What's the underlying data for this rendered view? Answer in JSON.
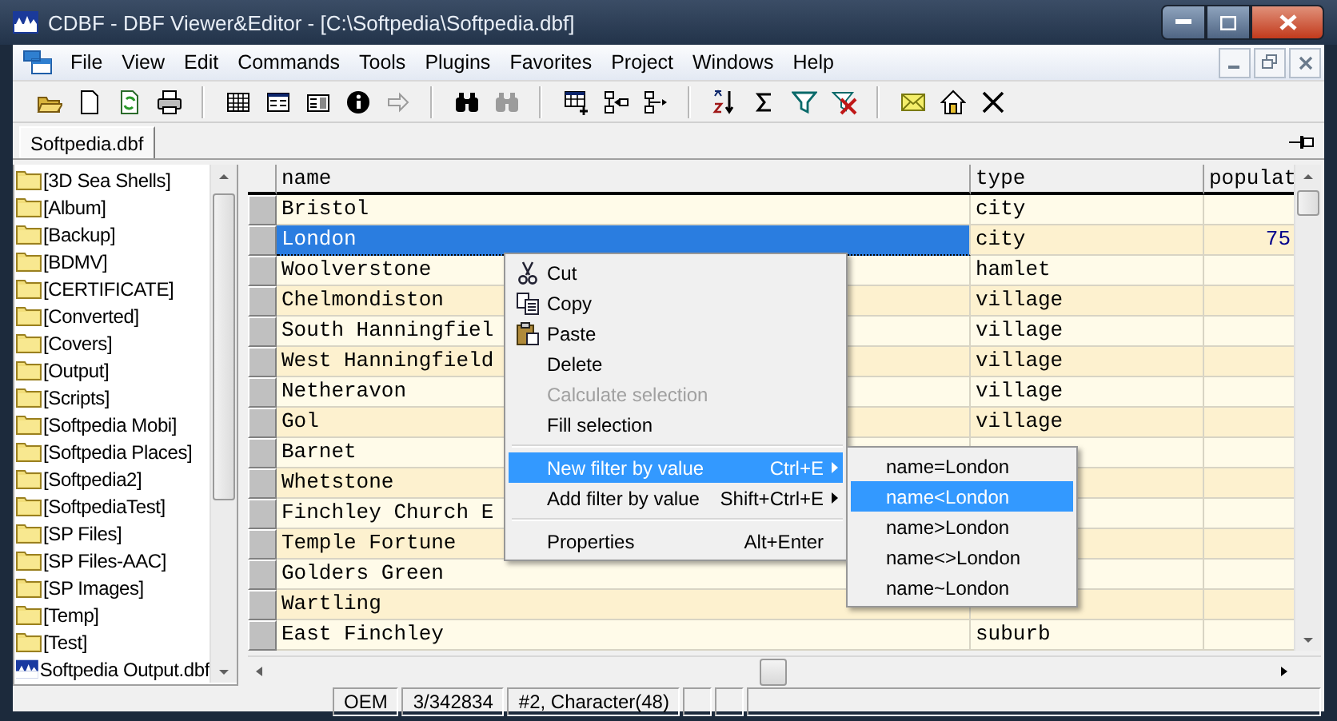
{
  "window": {
    "title": "CDBF - DBF Viewer&Editor - [C:\\Softpedia\\Softpedia.dbf]"
  },
  "menu_bar": [
    "File",
    "View",
    "Edit",
    "Commands",
    "Tools",
    "Plugins",
    "Favorites",
    "Project",
    "Windows",
    "Help"
  ],
  "toolbar": [
    {
      "kind": "open",
      "disabled": false
    },
    {
      "kind": "new",
      "disabled": false
    },
    {
      "kind": "refresh",
      "disabled": false
    },
    {
      "kind": "print",
      "disabled": false
    },
    {
      "kind": "separator"
    },
    {
      "kind": "grid",
      "disabled": false
    },
    {
      "kind": "form",
      "disabled": false
    },
    {
      "kind": "form2",
      "disabled": false
    },
    {
      "kind": "info",
      "disabled": false
    },
    {
      "kind": "arrow",
      "disabled": true
    },
    {
      "kind": "separator"
    },
    {
      "kind": "find",
      "disabled": false
    },
    {
      "kind": "find",
      "disabled": true
    },
    {
      "kind": "separator"
    },
    {
      "kind": "addrow",
      "disabled": false
    },
    {
      "kind": "colleft",
      "disabled": false
    },
    {
      "kind": "colright",
      "disabled": false
    },
    {
      "kind": "separator"
    },
    {
      "kind": "sort",
      "disabled": false
    },
    {
      "kind": "sum",
      "disabled": false
    },
    {
      "kind": "filter",
      "disabled": false
    },
    {
      "kind": "unfilter",
      "disabled": false
    },
    {
      "kind": "separator"
    },
    {
      "kind": "mail",
      "disabled": false
    },
    {
      "kind": "home",
      "disabled": false
    },
    {
      "kind": "cross",
      "disabled": false
    }
  ],
  "tabs": [
    {
      "label": "Softpedia.dbf",
      "selected": true
    }
  ],
  "sidebar": {
    "items": [
      {
        "label": "[3D Sea Shells]",
        "kind": "folder"
      },
      {
        "label": "[Album]",
        "kind": "folder"
      },
      {
        "label": "[Backup]",
        "kind": "folder"
      },
      {
        "label": "[BDMV]",
        "kind": "folder"
      },
      {
        "label": "[CERTIFICATE]",
        "kind": "folder"
      },
      {
        "label": "[Converted]",
        "kind": "folder"
      },
      {
        "label": "[Covers]",
        "kind": "folder"
      },
      {
        "label": "[Output]",
        "kind": "folder"
      },
      {
        "label": "[Scripts]",
        "kind": "folder"
      },
      {
        "label": "[Softpedia Mobi]",
        "kind": "folder"
      },
      {
        "label": "[Softpedia Places]",
        "kind": "folder"
      },
      {
        "label": "[Softpedia2]",
        "kind": "folder"
      },
      {
        "label": "[SoftpediaTest]",
        "kind": "folder"
      },
      {
        "label": "[SP Files]",
        "kind": "folder"
      },
      {
        "label": "[SP Files-AAC]",
        "kind": "folder"
      },
      {
        "label": "[SP Images]",
        "kind": "folder"
      },
      {
        "label": "[Temp]",
        "kind": "folder"
      },
      {
        "label": "[Test]",
        "kind": "folder"
      },
      {
        "label": "Softpedia Output.dbf",
        "kind": "file"
      }
    ]
  },
  "table": {
    "columns": [
      "name",
      "type",
      "populat"
    ],
    "rows": [
      {
        "name": "Bristol",
        "type": "city",
        "selected": false
      },
      {
        "name": "London",
        "type": "city",
        "populat": "75",
        "selected": true
      },
      {
        "name": "Woolverstone",
        "type": "hamlet",
        "selected": false
      },
      {
        "name": "Chelmondiston",
        "type": "village",
        "selected": false
      },
      {
        "name": "South Hanningfiel",
        "type": "village",
        "selected": false
      },
      {
        "name": "West Hanningfield",
        "type": "village",
        "selected": false
      },
      {
        "name": "Netheravon",
        "type": "village",
        "selected": false
      },
      {
        "name": "Gol",
        "type": "village",
        "selected": false
      },
      {
        "name": "Barnet",
        "selected": false
      },
      {
        "name": "Whetstone",
        "selected": false
      },
      {
        "name": "Finchley Church E",
        "selected": false
      },
      {
        "name": "Temple Fortune",
        "selected": false
      },
      {
        "name": "Golders Green",
        "selected": false
      },
      {
        "name": "Wartling",
        "selected": false
      },
      {
        "name": "East Finchley",
        "type": "suburb",
        "selected": false
      }
    ]
  },
  "context_menu": {
    "items": [
      {
        "kind": "item",
        "label": "Cut",
        "disabled": false,
        "selected": false
      },
      {
        "kind": "item",
        "label": "Copy",
        "disabled": false,
        "selected": false
      },
      {
        "kind": "item",
        "label": "Paste",
        "disabled": false,
        "selected": false
      },
      {
        "kind": "item",
        "label": "Delete",
        "disabled": false,
        "selected": false
      },
      {
        "kind": "item",
        "label": "Calculate selection",
        "disabled": true,
        "selected": false
      },
      {
        "kind": "item",
        "label": "Fill selection",
        "disabled": false,
        "selected": false
      },
      {
        "kind": "separator"
      },
      {
        "kind": "submenu",
        "label": "New filter by value",
        "shortcut": "Ctrl+E",
        "disabled": false,
        "selected": true
      },
      {
        "kind": "submenu",
        "label": "Add filter by value",
        "shortcut": "Shift+Ctrl+E",
        "disabled": false,
        "selected": false
      },
      {
        "kind": "separator"
      },
      {
        "kind": "item",
        "label": "Properties",
        "shortcut": "Alt+Enter",
        "disabled": false,
        "selected": false
      }
    ]
  },
  "submenu": {
    "items": [
      {
        "label": "name=London",
        "selected": false
      },
      {
        "label": "name<London",
        "selected": true
      },
      {
        "label": "name>London",
        "selected": false
      },
      {
        "label": "name<>London",
        "selected": false
      },
      {
        "label": "name~London",
        "selected": false
      }
    ]
  },
  "status_bar": [
    "OEM",
    "3/342834",
    "#2, Character(48)"
  ]
}
